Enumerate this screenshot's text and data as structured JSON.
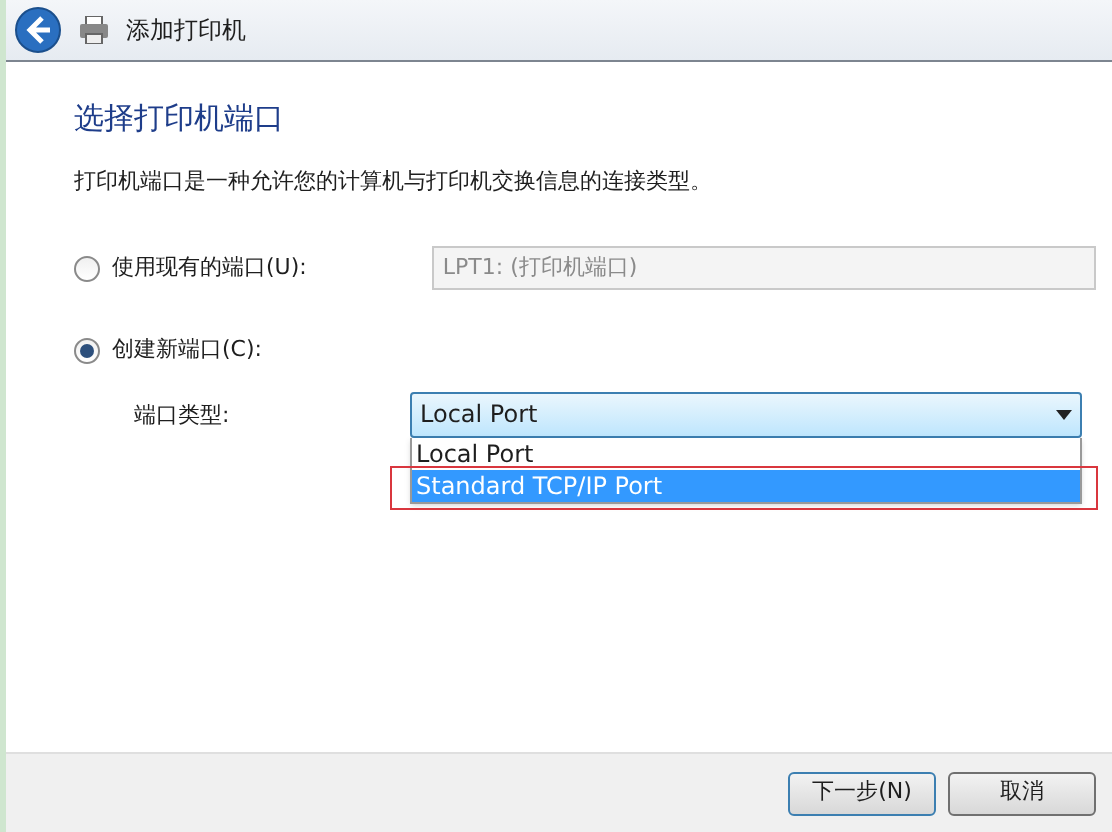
{
  "window": {
    "title": "添加打印机"
  },
  "heading": "选择打印机端口",
  "description": "打印机端口是一种允许您的计算机与打印机交换信息的连接类型。",
  "options": [
    {
      "label": "使用现有的端口(U):",
      "selected": false,
      "kind": "existing",
      "value": "LPT1: (打印机端口)"
    },
    {
      "label": "创建新端口(C):",
      "selected": true,
      "kind": "new",
      "field_label": "端口类型:",
      "value": "Local Port",
      "expanded": true,
      "list": [
        {
          "label": "Local Port",
          "highlighted": false
        },
        {
          "label": "Standard TCP/IP Port",
          "highlighted": true
        }
      ]
    }
  ],
  "buttons": [
    "下一步(N)",
    "取消"
  ]
}
